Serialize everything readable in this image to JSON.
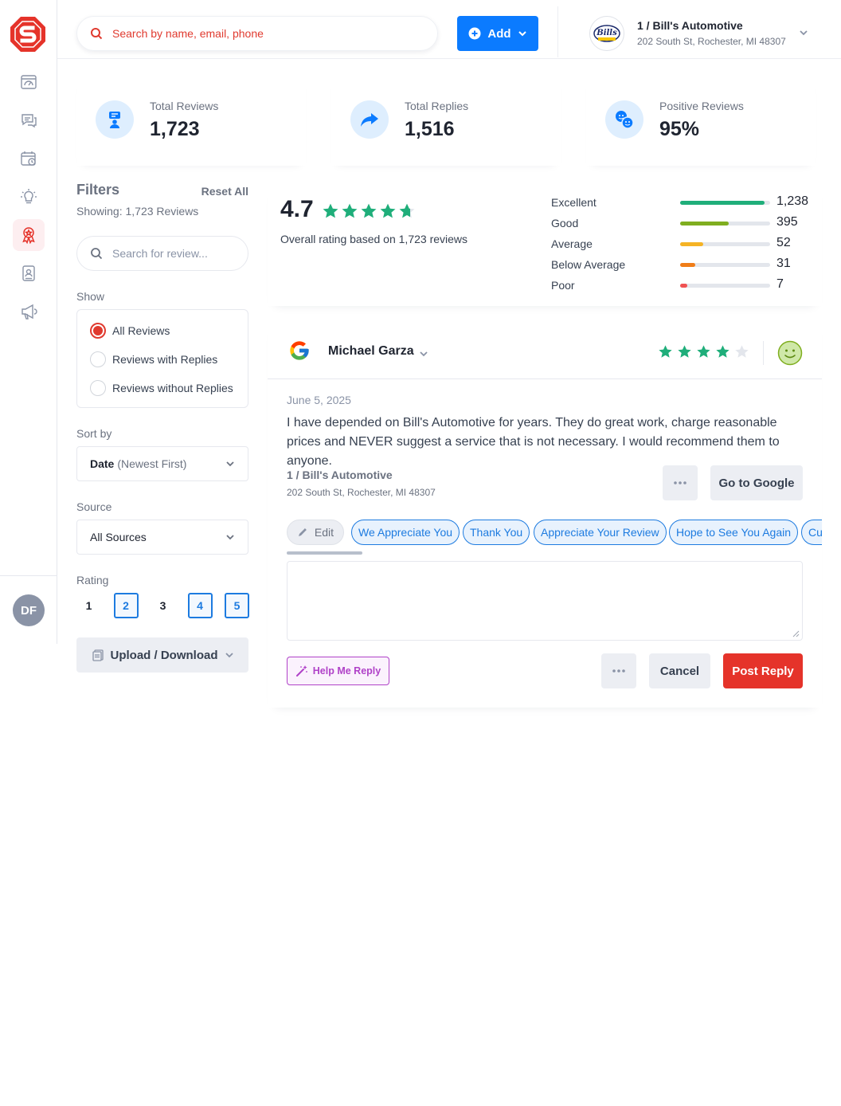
{
  "app": {
    "logo": "app-logo-s-octagon"
  },
  "rail": {
    "items": [
      {
        "icon": "dashboard-icon"
      },
      {
        "icon": "chat-icon"
      },
      {
        "icon": "calendar-icon"
      },
      {
        "icon": "lightbulb-icon"
      },
      {
        "icon": "award-ribbon-icon",
        "active": true
      },
      {
        "icon": "contact-card-icon"
      },
      {
        "icon": "megaphone-icon"
      }
    ],
    "avatar_initials": "DF"
  },
  "topbar": {
    "search_placeholder": "Search by name, email, phone",
    "add_label": "Add",
    "business_name": "1 / Bill's Automotive",
    "business_address": "202 South St, Rochester, MI 48307",
    "business_logo_text": "Bills"
  },
  "stats": [
    {
      "label": "Total Reviews",
      "value": "1,723",
      "icon": "reviewer-icon"
    },
    {
      "label": "Total Replies",
      "value": "1,516",
      "icon": "reply-arrow-icon"
    },
    {
      "label": "Positive Reviews",
      "value": "95%",
      "icon": "happy-faces-icon"
    }
  ],
  "filters": {
    "title": "Filters",
    "reset_label": "Reset All",
    "showing": "Showing: 1,723 Reviews",
    "search_placeholder": "Search for review...",
    "show_label": "Show",
    "show_options": [
      {
        "label": "All Reviews",
        "selected": true
      },
      {
        "label": "Reviews with Replies",
        "selected": false
      },
      {
        "label": "Reviews without Replies",
        "selected": false
      }
    ],
    "sort_label": "Sort by",
    "sort_value": "Date",
    "sort_value_sub": "(Newest First)",
    "source_label": "Source",
    "source_value": "All Sources",
    "rating_label": "Rating",
    "ratings": [
      {
        "value": "1",
        "selected": false
      },
      {
        "value": "2",
        "selected": true
      },
      {
        "value": "3",
        "selected": false
      },
      {
        "value": "4",
        "selected": true
      },
      {
        "value": "5",
        "selected": true
      }
    ],
    "upload_label": "Upload / Download"
  },
  "summary": {
    "rating": "4.7",
    "stars": 4.7,
    "text": "Overall rating based on 1,723 reviews",
    "breakdown": [
      {
        "label": "Excellent",
        "count": "1,238",
        "fraction": 0.94,
        "color": "#1fae7a"
      },
      {
        "label": "Good",
        "count": "395",
        "fraction": 0.54,
        "color": "#7fae1f"
      },
      {
        "label": "Average",
        "count": "52",
        "fraction": 0.26,
        "color": "#f5b325"
      },
      {
        "label": "Below Average",
        "count": "31",
        "fraction": 0.17,
        "color": "#f07d18"
      },
      {
        "label": "Poor",
        "count": "7",
        "fraction": 0.08,
        "color": "#f05252"
      }
    ]
  },
  "review": {
    "source_icon": "google-icon",
    "reviewer": "Michael Garza",
    "stars": 4,
    "sentiment_icon": "smiley-face-icon",
    "date": "June 5, 2025",
    "text": "I have depended on Bill's Automotive for years. They do great work, charge reasonable prices and NEVER suggest a service that is not necessary. I would recommend them to anyone.",
    "location_name": "1 / Bill's Automotive",
    "location_address": "202 South St, Rochester, MI 48307",
    "go_to_label": "Go to Google",
    "edit_label": "Edit",
    "chips": [
      "We Appreciate You",
      "Thank You",
      "Appreciate Your Review",
      "Hope to See You Again",
      "Cu"
    ],
    "help_label": "Help Me Reply",
    "cancel_label": "Cancel",
    "post_label": "Post Reply"
  },
  "colors": {
    "brand_red": "#e5332a",
    "primary_blue": "#0b7bff",
    "star_green": "#1fae7a",
    "ai_purple": "#b042c8"
  }
}
